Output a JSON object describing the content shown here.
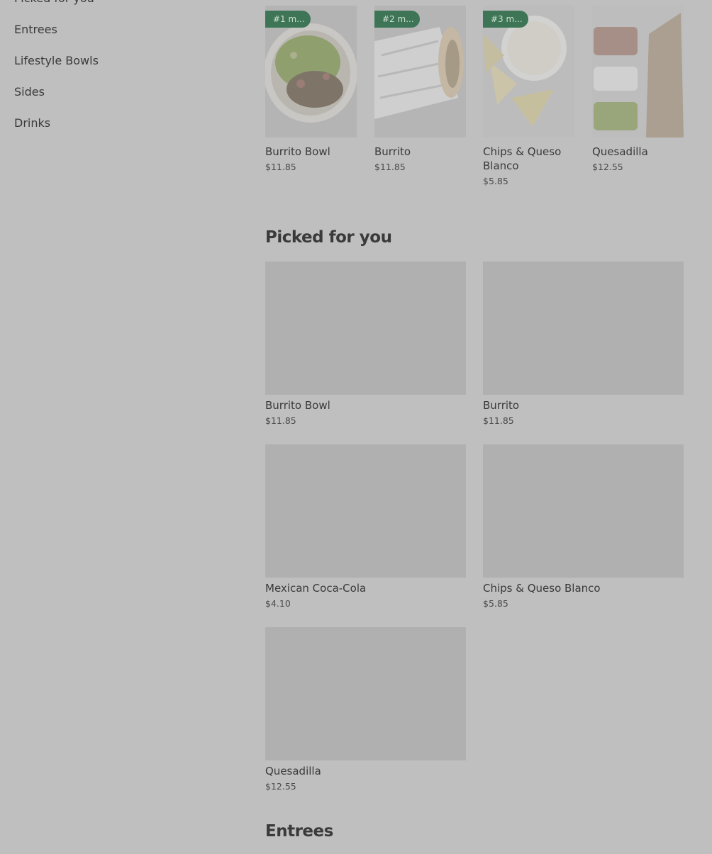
{
  "sidebar": {
    "items": [
      {
        "label": "Picked for you"
      },
      {
        "label": "Entrees"
      },
      {
        "label": "Lifestyle Bowls"
      },
      {
        "label": "Sides"
      },
      {
        "label": "Drinks"
      }
    ]
  },
  "featured": [
    {
      "badge": "#1 m...",
      "name": "Burrito Bowl",
      "price": "$11.85",
      "image": "burrito-bowl-photo"
    },
    {
      "badge": "#2 m...",
      "name": "Burrito",
      "price": "$11.85",
      "image": "burrito-photo"
    },
    {
      "badge": "#3 m...",
      "name": "Chips & Queso Blanco",
      "price": "$5.85",
      "image": "chips-queso-photo"
    },
    {
      "badge": "",
      "name": "Quesadilla",
      "price": "$12.55",
      "image": "quesadilla-photo"
    }
  ],
  "picked": {
    "title": "Picked for you",
    "items": [
      {
        "name": "Burrito Bowl",
        "price": "$11.85"
      },
      {
        "name": "Burrito",
        "price": "$11.85"
      },
      {
        "name": "Mexican Coca-Cola",
        "price": "$4.10"
      },
      {
        "name": "Chips & Queso Blanco",
        "price": "$5.85"
      },
      {
        "name": "Quesadilla",
        "price": "$12.55"
      }
    ]
  },
  "entrees": {
    "title": "Entrees"
  },
  "colors": {
    "background": "#bfbfbf",
    "badge": "#3d7556",
    "placeholder": "#b0b0b0"
  }
}
